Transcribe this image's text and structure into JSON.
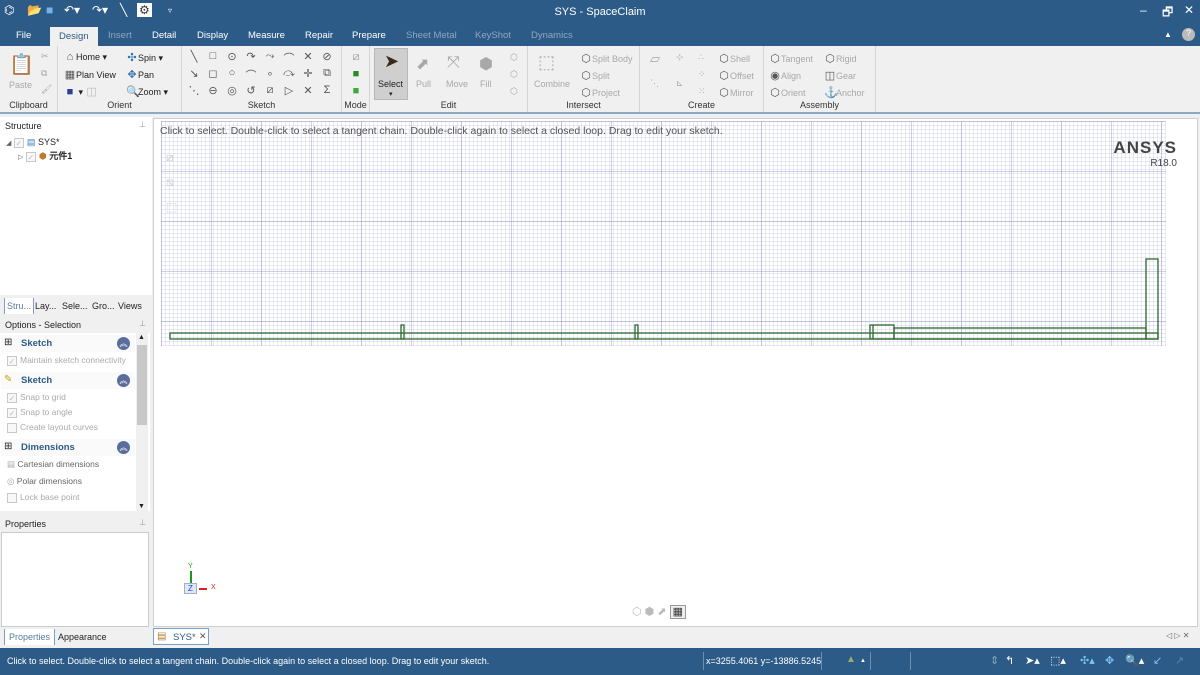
{
  "window": {
    "title": "SYS - SpaceClaim",
    "controls": [
      "–",
      "🗗",
      "✕"
    ]
  },
  "quick_access": {
    "icons": [
      "app-icon",
      "open-icon",
      "save-icon",
      "undo-icon",
      "redo-icon",
      "tool-icon",
      "settings-icon"
    ]
  },
  "menu_tabs": [
    {
      "label": "File",
      "state": "normal"
    },
    {
      "label": "Design",
      "state": "active"
    },
    {
      "label": "Insert",
      "state": "disabled"
    },
    {
      "label": "Detail",
      "state": "normal"
    },
    {
      "label": "Display",
      "state": "normal"
    },
    {
      "label": "Measure",
      "state": "normal"
    },
    {
      "label": "Repair",
      "state": "normal"
    },
    {
      "label": "Prepare",
      "state": "normal"
    },
    {
      "label": "Sheet Metal",
      "state": "disabled"
    },
    {
      "label": "KeyShot",
      "state": "disabled"
    },
    {
      "label": "Dynamics",
      "state": "disabled"
    }
  ],
  "ribbon": {
    "clipboard": {
      "label": "Clipboard",
      "paste": "Paste"
    },
    "orient": {
      "label": "Orient",
      "home": "Home",
      "plan_view": "Plan View",
      "spin": "Spin",
      "pan": "Pan",
      "zoom": "Zoom"
    },
    "sketch": {
      "label": "Sketch",
      "tools": [
        "╲",
        "□",
        "⊙",
        "↷",
        "⤳",
        "⌒",
        "✕",
        "⊘",
        "↘",
        "◻",
        "○",
        "⌒",
        "∘",
        "⤼",
        "✛",
        "⧉",
        "⋱",
        "⊖",
        "◎",
        "↺",
        "⧄",
        "▷",
        "✕",
        "Σ"
      ]
    },
    "mode": {
      "label": "Mode"
    },
    "edit": {
      "label": "Edit",
      "select": "Select",
      "pull": "Pull",
      "move": "Move",
      "fill": "Fill"
    },
    "intersect": {
      "label": "Intersect",
      "combine": "Combine",
      "split_body": "Split Body",
      "split": "Split",
      "project": "Project"
    },
    "create": {
      "label": "Create",
      "shell": "Shell",
      "offset": "Offset",
      "mirror": "Mirror"
    },
    "assembly": {
      "label": "Assembly",
      "tangent": "Tangent",
      "align": "Align",
      "orient": "Orient",
      "rigid": "Rigid",
      "gear": "Gear",
      "anchor": "Anchor"
    }
  },
  "structure": {
    "title": "Structure",
    "root": "SYS*",
    "child": "元件1",
    "tabs": [
      "Stru...",
      "Lay...",
      "Sele...",
      "Gro...",
      "Views"
    ]
  },
  "options": {
    "title": "Options - Selection",
    "sections": [
      {
        "title": "Sketch",
        "items": [
          {
            "label": "Maintain sketch connectivity",
            "checked": true
          }
        ]
      },
      {
        "title": "Sketch",
        "items": [
          {
            "label": "Snap to grid",
            "checked": true
          },
          {
            "label": "Snap to angle",
            "checked": true
          },
          {
            "label": "Create layout curves",
            "checked": false
          }
        ]
      },
      {
        "title": "Dimensions",
        "items": [
          {
            "label": "Cartesian dimensions"
          },
          {
            "label": "Polar dimensions"
          },
          {
            "label": "Lock base point",
            "checked": false
          }
        ]
      }
    ]
  },
  "properties": {
    "title": "Properties",
    "tabs": [
      "Properties",
      "Appearance"
    ]
  },
  "viewport": {
    "hint": "Click to select. Double-click to select a tangent chain. Double-click again to select a closed loop. Drag to edit your sketch.",
    "logo": "ANSYS",
    "version": "R18.0",
    "axes": {
      "x": "X",
      "y": "Y",
      "z": "Z"
    },
    "sketch_color": "#2f6b2f"
  },
  "document_tab": {
    "label": "SYS*"
  },
  "status": {
    "message": "Click to select. Double-click to select a tangent chain. Double-click again to select a closed loop. Drag to edit your sketch.",
    "coords": "x=3255.4061  y=-13886.5245"
  }
}
